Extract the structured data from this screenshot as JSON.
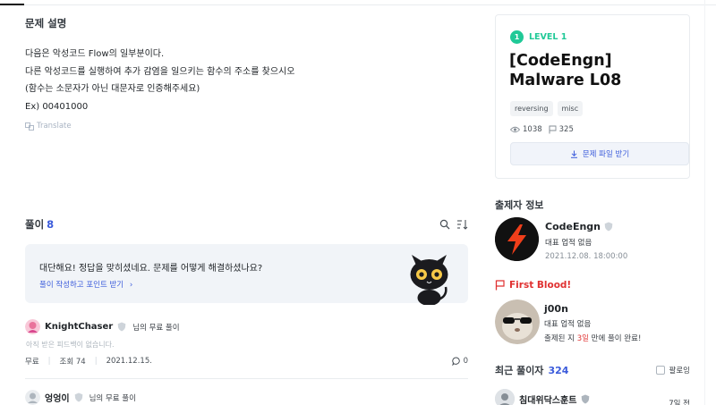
{
  "description": {
    "heading": "문제 설명",
    "lines": [
      "다음은 악성코드 Flow의 일부분이다.",
      "다른 악성코드를 실행하여 추가 감염을 일으키는 함수의 주소를 찾으시오",
      "(함수는 소문자가 아닌 대문자로 인증해주세요)",
      "Ex) 00401000"
    ],
    "translate_label": "Translate"
  },
  "solutions": {
    "heading": "풀이",
    "count": "8",
    "banner_message": "대단해요! 정답을 맞히셨네요. 문제를 어떻게 해결하셨나요?",
    "banner_link": "풀이 작성하고 포인트 받기",
    "items": [
      {
        "name": "KnightChaser",
        "subtitle": "님의 무료 풀이",
        "feedback": "아직 받은 피드백이 없습니다.",
        "price": "무료",
        "views": "조회 74",
        "date": "2021.12.15.",
        "comments": "0"
      },
      {
        "name": "엉엉이",
        "subtitle": "님의 무료 풀이"
      }
    ]
  },
  "challenge": {
    "level_number": "1",
    "level_label": "LEVEL 1",
    "title": "[CodeEngn] Malware L08",
    "tags": [
      "reversing",
      "misc"
    ],
    "views": "1038",
    "solves": "325",
    "download_label": "문제 파일 받기"
  },
  "author": {
    "heading": "출제자 정보",
    "name": "CodeEngn",
    "achievement": "대표 업적 없음",
    "date": "2021.12.08. 18:00:00"
  },
  "first_blood": {
    "heading": "First Blood!",
    "name": "j00n",
    "achievement": "대표 업적 없음",
    "message_prefix": "출제된 지",
    "message_days": "3일",
    "message_suffix": "만에 풀이 완료!"
  },
  "recent_solvers": {
    "heading": "최근 풀이자",
    "count": "324",
    "follow_label": "팔로잉",
    "items": [
      {
        "name": "침대위닥스훈트",
        "time": "7일 전"
      }
    ]
  },
  "colors": {
    "accent": "#3b5bdb",
    "level": "#20c997",
    "first_blood": "#e03131"
  }
}
